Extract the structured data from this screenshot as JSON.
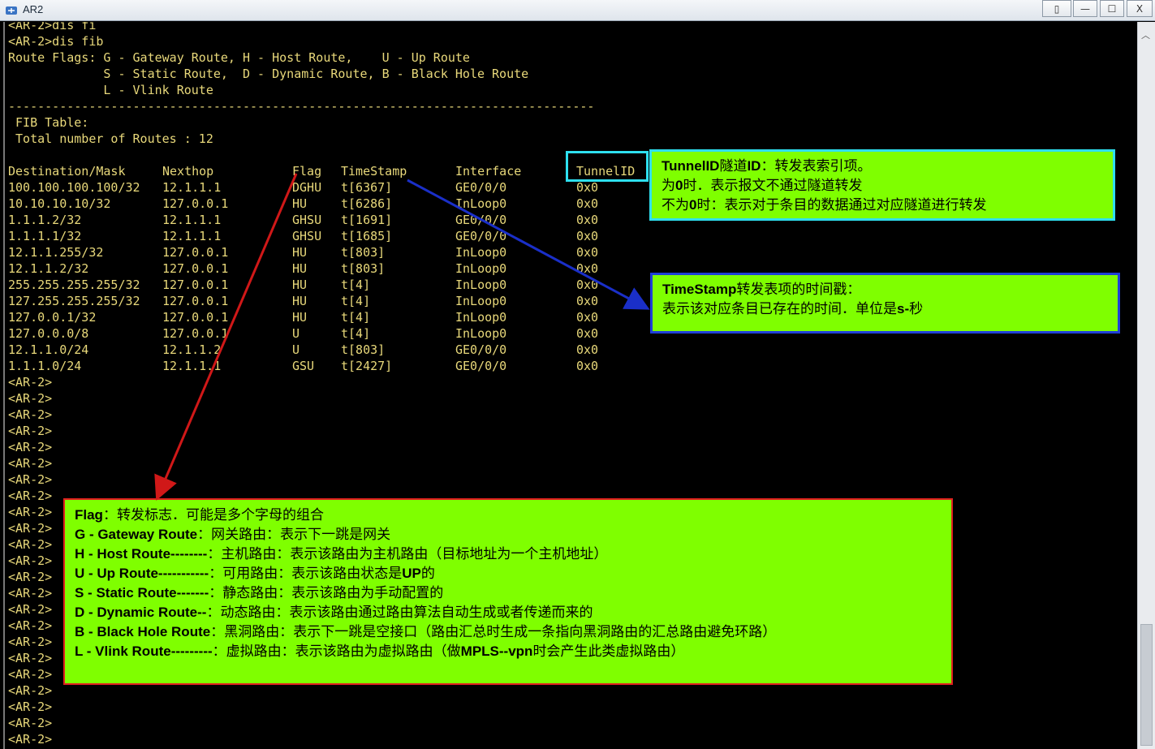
{
  "window": {
    "title": "AR2",
    "buttons": [
      "▯",
      "—",
      "☐",
      "X"
    ],
    "icon": "router-app-icon"
  },
  "terminal": {
    "lines_top": [
      "<AR-2>dis fi",
      "<AR-2>dis fib",
      "Route Flags: G - Gateway Route, H - Host Route,    U - Up Route",
      "             S - Static Route,  D - Dynamic Route, B - Black Hole Route",
      "             L - Vlink Route",
      "--------------------------------------------------------------------------------",
      " FIB Table:",
      " Total number of Routes : 12",
      ""
    ],
    "columns": [
      "Destination/Mask",
      "Nexthop",
      "Flag",
      "TimeStamp",
      "Interface",
      "TunnelID"
    ],
    "routes": [
      [
        "100.100.100.100/32",
        "12.1.1.1",
        "DGHU",
        "t[6367]",
        "GE0/0/0",
        "0x0"
      ],
      [
        "10.10.10.10/32",
        "127.0.0.1",
        "HU",
        "t[6286]",
        "InLoop0",
        "0x0"
      ],
      [
        "1.1.1.2/32",
        "12.1.1.1",
        "GHSU",
        "t[1691]",
        "GE0/0/0",
        "0x0"
      ],
      [
        "1.1.1.1/32",
        "12.1.1.1",
        "GHSU",
        "t[1685]",
        "GE0/0/0",
        "0x0"
      ],
      [
        "12.1.1.255/32",
        "127.0.0.1",
        "HU",
        "t[803]",
        "InLoop0",
        "0x0"
      ],
      [
        "12.1.1.2/32",
        "127.0.0.1",
        "HU",
        "t[803]",
        "InLoop0",
        "0x0"
      ],
      [
        "255.255.255.255/32",
        "127.0.0.1",
        "HU",
        "t[4]",
        "InLoop0",
        "0x0"
      ],
      [
        "127.255.255.255/32",
        "127.0.0.1",
        "HU",
        "t[4]",
        "InLoop0",
        "0x0"
      ],
      [
        "127.0.0.1/32",
        "127.0.0.1",
        "HU",
        "t[4]",
        "InLoop0",
        "0x0"
      ],
      [
        "127.0.0.0/8",
        "127.0.0.1",
        "U",
        "t[4]",
        "InLoop0",
        "0x0"
      ],
      [
        "12.1.1.0/24",
        "12.1.1.2",
        "U",
        "t[803]",
        "GE0/0/0",
        "0x0"
      ],
      [
        "1.1.1.0/24",
        "12.1.1.1",
        "GSU",
        "t[2427]",
        "GE0/0/0",
        "0x0"
      ]
    ],
    "prompt": "<AR-2>",
    "prompt_count": 23
  },
  "annotations": {
    "tunnel": {
      "title_bold": "TunnelID",
      "title_rest": "隧道",
      "title_bold2": "ID",
      "title_tail": "：转发表索引项。",
      "line2_pre": "为",
      "line2_bold": "0",
      "line2_post": "时．表示报文不通过隧道转发",
      "line3_pre": "不为",
      "line3_bold": "0",
      "line3_post": "时：表示对于条目的数据通过对应隧道进行转发"
    },
    "timestamp": {
      "title_bold": "TimeStamp",
      "title_rest": "转发表项的时间戳：",
      "line2_pre": "表示该对应条目已存在的时间．单位是",
      "line2_bold": "s-",
      "line2_post": "秒"
    },
    "flag": {
      "lines": [
        {
          "bold": "Flag",
          "text": "：转发标志．可能是多个字母的组合"
        },
        {
          "bold": "G - Gateway Route",
          "text": "：网关路由：表示下一跳是网关"
        },
        {
          "bold": "H - Host Route--------",
          "text": "：主机路由：表示该路由为主机路由（目标地址为一个主机地址）"
        },
        {
          "bold": "U - Up Route-----------",
          "text": "：可用路由：表示该路由状态是",
          "bold2": "UP",
          "tail": "的"
        },
        {
          "bold": "S - Static Route-------",
          "text": "：静态路由：表示该路由为手动配置的"
        },
        {
          "bold": "D - Dynamic Route--",
          "text": "：动态路由：表示该路由通过路由算法自动生成或者传递而来的"
        },
        {
          "bold": "B - Black Hole Route",
          "text": "：黑洞路由：表示下一跳是空接口（路由汇总时生成一条指向黑洞路由的汇总路由避免环路）"
        },
        {
          "bold": "L - Vlink Route---------",
          "text": "：虚拟路由：表示该路由为虚拟路由（做",
          "bold2": "MPLS--vpn",
          "tail": "时会产生此类虚拟路由）"
        }
      ]
    }
  },
  "colors": {
    "terminal_bg": "#000000",
    "terminal_text": "#e8d87a",
    "callout_bg": "#7fff00",
    "tunnel_border": "#2ee0f0",
    "timestamp_border": "#1f3fd8",
    "flag_border": "#e02020"
  }
}
